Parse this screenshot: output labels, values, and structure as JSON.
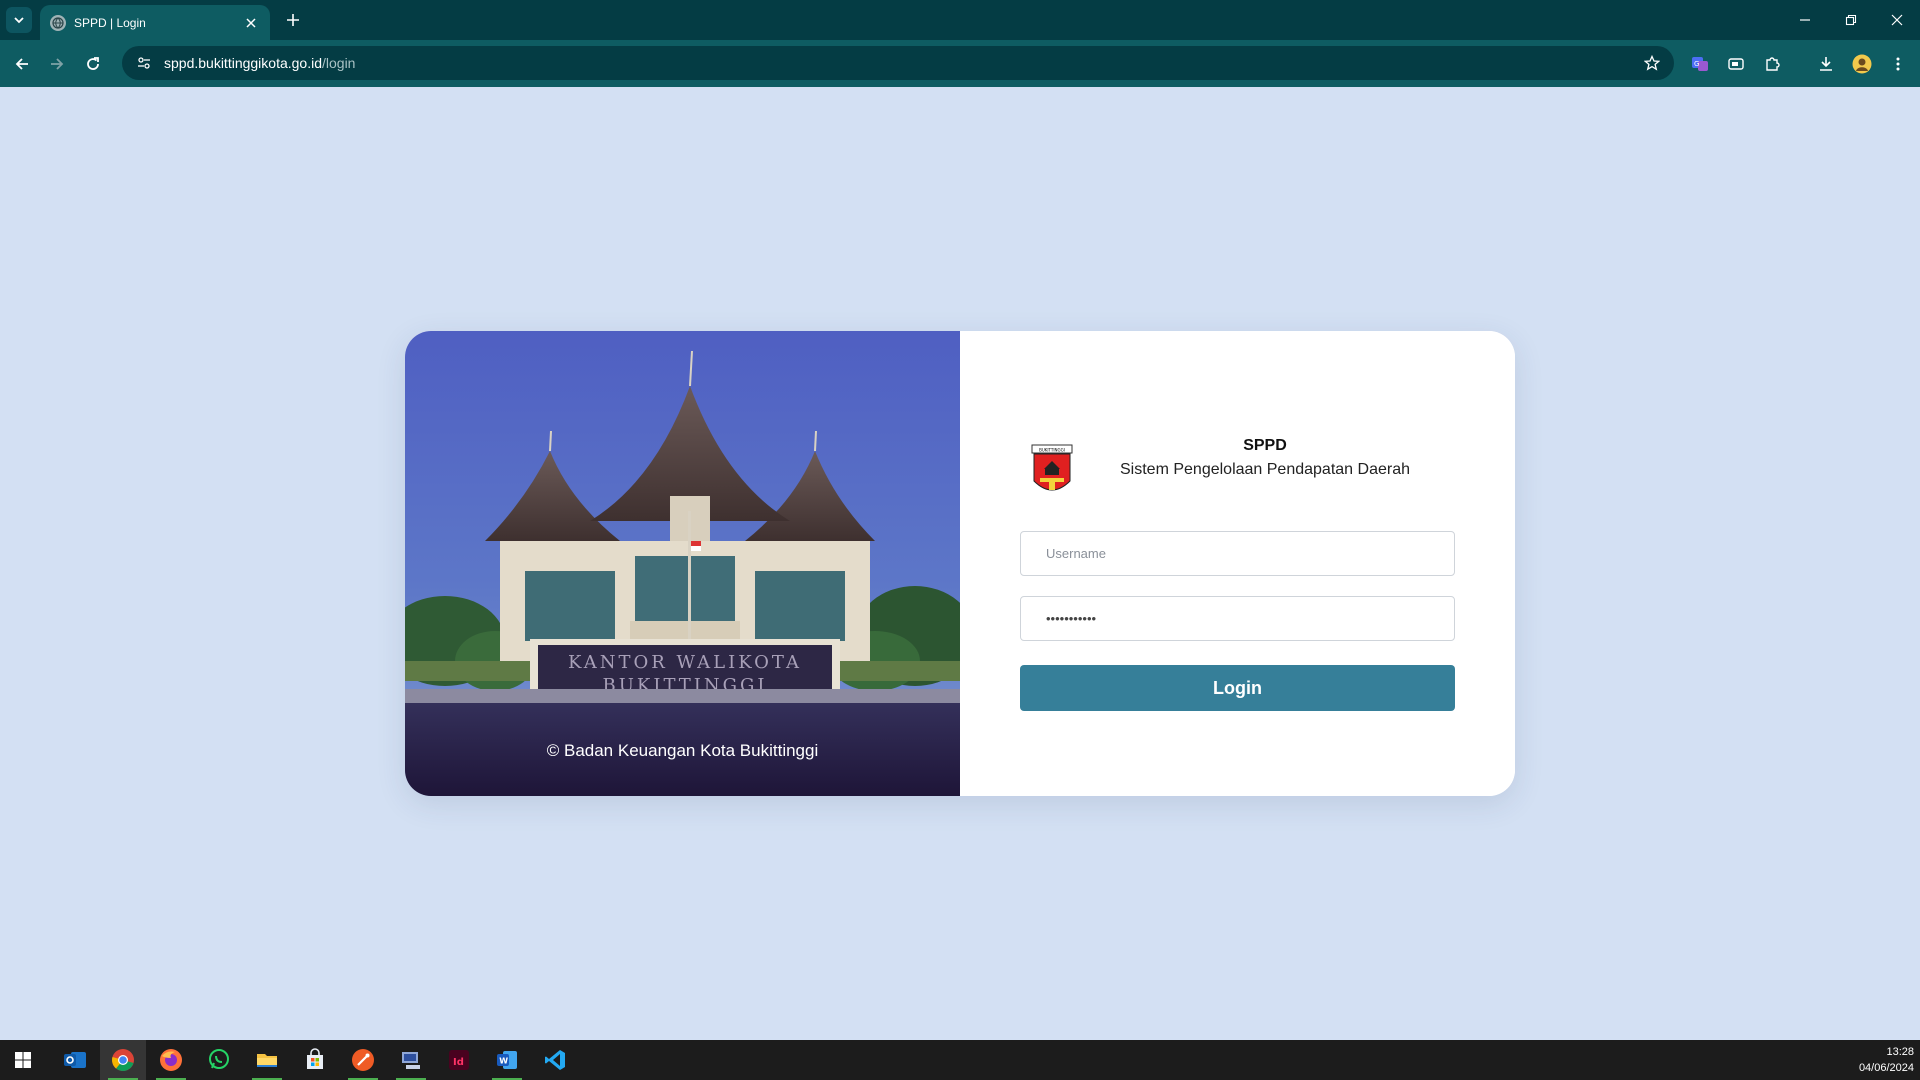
{
  "browser": {
    "tab_title": "SPPD | Login",
    "url_host": "sppd.bukittinggikota.go.id",
    "url_path": "/login"
  },
  "page": {
    "copyright": "© Badan Keuangan Kota Bukittinggi",
    "photo_sign_line1": "KANTOR WALIKOTA",
    "photo_sign_line2": "BUKITTINGGI",
    "logo_text": "BUKITTINGGI",
    "app_title": "SPPD",
    "app_subtitle": "Sistem Pengelolaan Pendapatan Daerah",
    "username_placeholder": "Username",
    "password_value": "•••••••••••",
    "login_label": "Login",
    "accent_color": "#367f99"
  },
  "taskbar": {
    "apps": [
      "windows-start",
      "outlook",
      "chrome",
      "firefox",
      "whatsapp",
      "file-explorer",
      "microsoft-store",
      "postman",
      "app-launcher",
      "indesign",
      "word",
      "vscode"
    ],
    "time": "13:28",
    "date": "04/06/2024"
  }
}
